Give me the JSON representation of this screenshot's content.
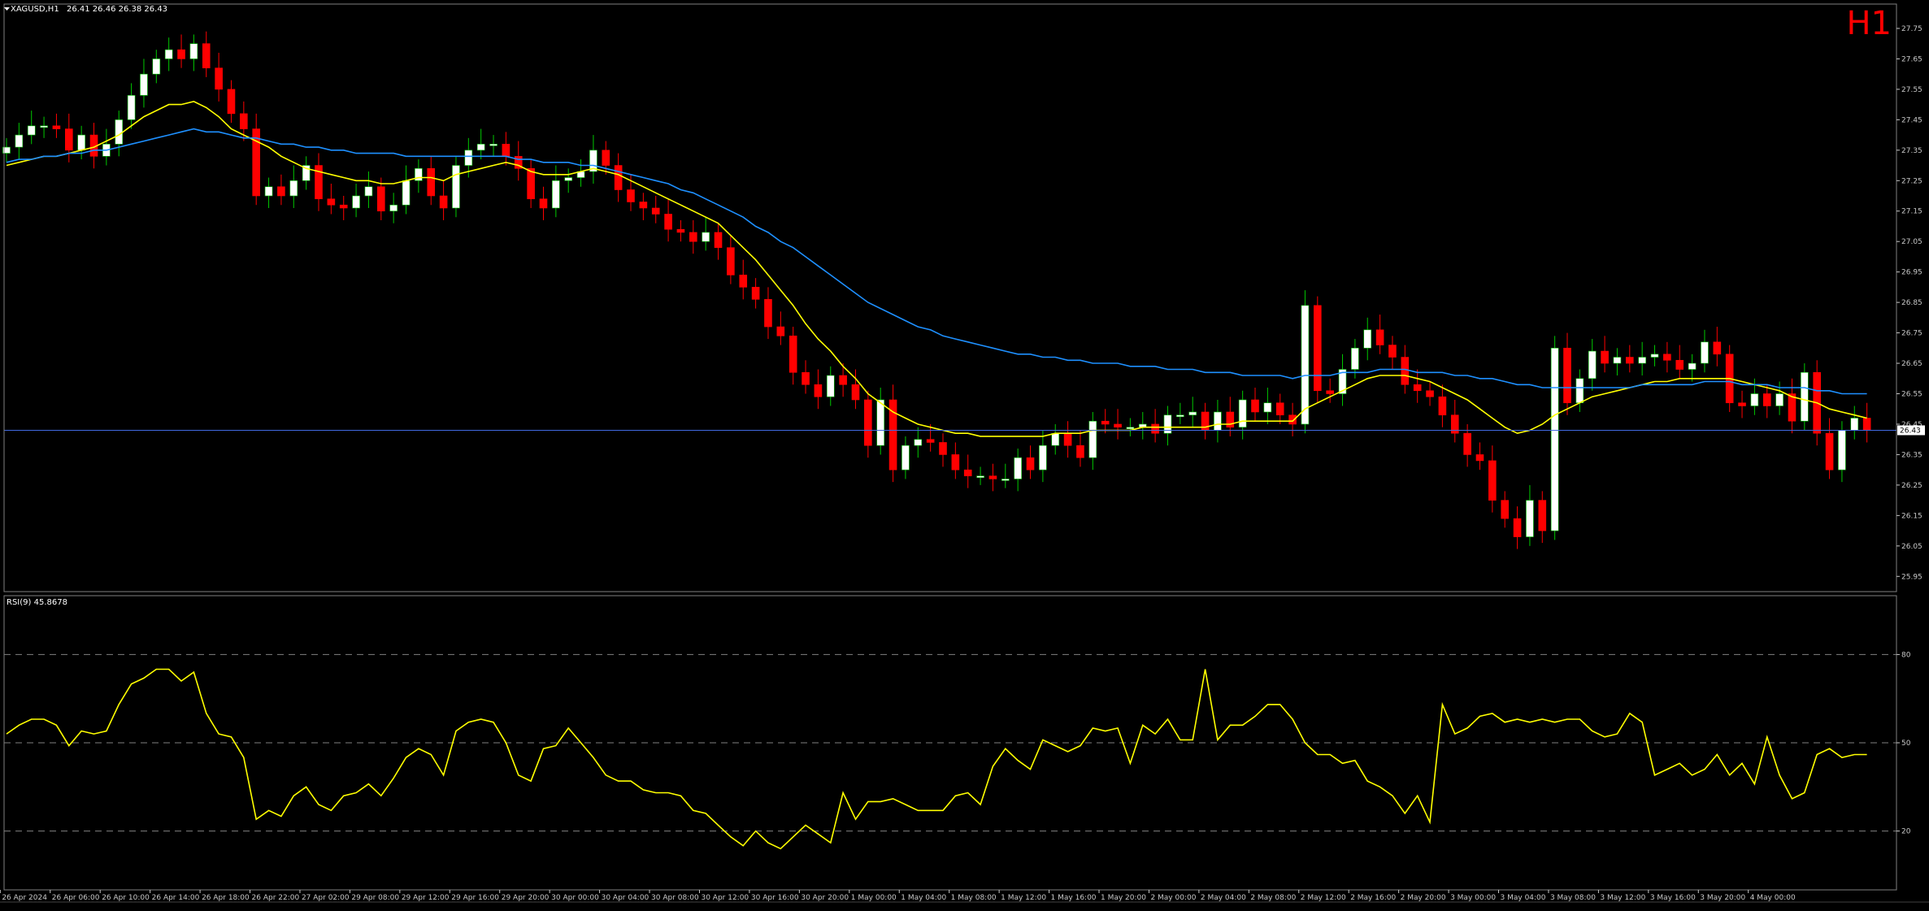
{
  "header": {
    "symbol": "XAGUSD,H1",
    "ohlc": "26.41 26.46 26.38 26.43",
    "timeframe": "H1"
  },
  "indicator": {
    "label": "RSI(9) 45.8678"
  },
  "colors": {
    "background": "#000000",
    "bull_body": "#ffffff",
    "bear_body": "#ff0000",
    "bull_wick": "#00c800",
    "bear_wick": "#ff0000",
    "ma_fast": "#ffff00",
    "ma_slow": "#1e90ff",
    "rsi": "#ffff00",
    "price_line": "#4169e1",
    "axis_text": "#c8c8c8",
    "timeframe_label": "#ff0000"
  },
  "chart_data": [
    {
      "type": "candlestick",
      "title": "XAGUSD,H1",
      "ylim": [
        25.9,
        27.83
      ],
      "y_ticks": [
        "27.75",
        "27.65",
        "27.55",
        "27.45",
        "27.35",
        "27.25",
        "27.15",
        "27.05",
        "26.95",
        "26.85",
        "26.75",
        "26.65",
        "26.55",
        "26.45",
        "26.35",
        "26.25",
        "26.15",
        "26.05",
        "25.95"
      ],
      "x_ticks": [
        "26 Apr 2024",
        "26 Apr 06:00",
        "26 Apr 10:00",
        "26 Apr 14:00",
        "26 Apr 18:00",
        "26 Apr 22:00",
        "27 Apr 02:00",
        "29 Apr 08:00",
        "29 Apr 12:00",
        "29 Apr 16:00",
        "29 Apr 20:00",
        "30 Apr 00:00",
        "30 Apr 04:00",
        "30 Apr 08:00",
        "30 Apr 12:00",
        "30 Apr 16:00",
        "30 Apr 20:00",
        "1 May 00:00",
        "1 May 04:00",
        "1 May 08:00",
        "1 May 12:00",
        "1 May 16:00",
        "1 May 20:00",
        "2 May 00:00",
        "2 May 04:00",
        "2 May 08:00",
        "2 May 12:00",
        "2 May 16:00",
        "2 May 20:00",
        "3 May 00:00",
        "3 May 04:00",
        "3 May 08:00",
        "3 May 12:00",
        "3 May 16:00",
        "3 May 20:00",
        "4 May 00:00"
      ],
      "current_price": "26.43",
      "closes": [
        27.36,
        27.4,
        27.43,
        27.43,
        27.42,
        27.35,
        27.4,
        27.33,
        27.37,
        27.45,
        27.53,
        27.6,
        27.65,
        27.68,
        27.65,
        27.7,
        27.62,
        27.55,
        27.47,
        27.42,
        27.2,
        27.23,
        27.2,
        27.25,
        27.3,
        27.19,
        27.17,
        27.16,
        27.2,
        27.23,
        27.15,
        27.17,
        27.25,
        27.29,
        27.2,
        27.16,
        27.3,
        27.35,
        27.37,
        27.37,
        27.33,
        27.29,
        27.19,
        27.16,
        27.25,
        27.26,
        27.28,
        27.35,
        27.3,
        27.22,
        27.18,
        27.16,
        27.14,
        27.09,
        27.08,
        27.05,
        27.08,
        27.03,
        26.94,
        26.9,
        26.86,
        26.77,
        26.74,
        26.62,
        26.58,
        26.54,
        26.61,
        26.58,
        26.53,
        26.38,
        26.53,
        26.3,
        26.38,
        26.4,
        26.39,
        26.35,
        26.3,
        26.28,
        26.28,
        26.27,
        26.27,
        26.34,
        26.3,
        26.38,
        26.42,
        26.38,
        26.34,
        26.46,
        26.45,
        26.44,
        26.44,
        26.45,
        26.42,
        26.48,
        26.48,
        26.49,
        26.43,
        26.49,
        26.44,
        26.53,
        26.49,
        26.52,
        26.48,
        26.45,
        26.84,
        26.56,
        26.55,
        26.63,
        26.7,
        26.76,
        26.71,
        26.67,
        26.58,
        26.56,
        26.54,
        26.48,
        26.42,
        26.35,
        26.33,
        26.2,
        26.14,
        26.08,
        26.2,
        26.1,
        26.7,
        26.52,
        26.6,
        26.69,
        26.65,
        26.67,
        26.65,
        26.67,
        26.68,
        26.66,
        26.63,
        26.65,
        26.72,
        26.68,
        26.52,
        26.51,
        26.55,
        26.51,
        26.55,
        26.46,
        26.62,
        26.42,
        26.3,
        26.43,
        26.47,
        26.43
      ],
      "series": [
        {
          "name": "MA",
          "color": "#ffff00",
          "values": [
            27.3,
            27.31,
            27.32,
            27.33,
            27.33,
            27.34,
            27.35,
            27.36,
            27.38,
            27.4,
            27.43,
            27.46,
            27.48,
            27.5,
            27.5,
            27.51,
            27.49,
            27.46,
            27.42,
            27.4,
            27.38,
            27.36,
            27.33,
            27.31,
            27.29,
            27.28,
            27.27,
            27.26,
            27.25,
            27.25,
            27.24,
            27.24,
            27.25,
            27.26,
            27.26,
            27.25,
            27.27,
            27.28,
            27.29,
            27.3,
            27.31,
            27.3,
            27.28,
            27.27,
            27.27,
            27.27,
            27.28,
            27.29,
            27.28,
            27.27,
            27.25,
            27.23,
            27.21,
            27.19,
            27.17,
            27.15,
            27.13,
            27.11,
            27.07,
            27.03,
            26.99,
            26.94,
            26.89,
            26.84,
            26.78,
            26.73,
            26.69,
            26.64,
            26.6,
            26.55,
            26.52,
            26.49,
            26.47,
            26.45,
            26.44,
            26.43,
            26.42,
            26.42,
            26.41,
            26.41,
            26.41,
            26.41,
            26.41,
            26.41,
            26.42,
            26.42,
            26.42,
            26.43,
            26.43,
            26.43,
            26.43,
            26.44,
            26.44,
            26.44,
            26.44,
            26.44,
            26.44,
            26.45,
            26.45,
            26.46,
            26.46,
            26.46,
            26.46,
            26.46,
            26.5,
            26.52,
            26.54,
            26.56,
            26.58,
            26.6,
            26.61,
            26.61,
            26.61,
            26.6,
            26.59,
            26.57,
            26.55,
            26.53,
            26.5,
            26.47,
            26.44,
            26.42,
            26.43,
            26.45,
            26.48,
            26.5,
            26.52,
            26.54,
            26.55,
            26.56,
            26.57,
            26.58,
            26.59,
            26.59,
            26.6,
            26.6,
            26.6,
            26.6,
            26.6,
            26.59,
            26.58,
            26.57,
            26.56,
            26.54,
            26.53,
            26.52,
            26.5,
            26.49,
            26.48,
            26.47
          ]
        },
        {
          "name": "MA",
          "color": "#1e90ff",
          "values": [
            27.31,
            27.32,
            27.32,
            27.33,
            27.33,
            27.34,
            27.34,
            27.35,
            27.35,
            27.36,
            27.37,
            27.38,
            27.39,
            27.4,
            27.41,
            27.42,
            27.41,
            27.41,
            27.4,
            27.39,
            27.39,
            27.38,
            27.37,
            27.37,
            27.36,
            27.36,
            27.35,
            27.35,
            27.34,
            27.34,
            27.34,
            27.34,
            27.33,
            27.33,
            27.33,
            27.33,
            27.33,
            27.33,
            27.33,
            27.33,
            27.33,
            27.32,
            27.32,
            27.31,
            27.31,
            27.31,
            27.3,
            27.3,
            27.29,
            27.28,
            27.27,
            27.26,
            27.25,
            27.24,
            27.22,
            27.21,
            27.19,
            27.17,
            27.15,
            27.13,
            27.1,
            27.08,
            27.05,
            27.03,
            27.0,
            26.97,
            26.94,
            26.91,
            26.88,
            26.85,
            26.83,
            26.81,
            26.79,
            26.77,
            26.76,
            26.74,
            26.73,
            26.72,
            26.71,
            26.7,
            26.69,
            26.68,
            26.68,
            26.67,
            26.67,
            26.66,
            26.66,
            26.65,
            26.65,
            26.65,
            26.64,
            26.64,
            26.64,
            26.63,
            26.63,
            26.63,
            26.62,
            26.62,
            26.62,
            26.61,
            26.61,
            26.61,
            26.61,
            26.6,
            26.61,
            26.61,
            26.61,
            26.62,
            26.62,
            26.62,
            26.63,
            26.63,
            26.63,
            26.62,
            26.62,
            26.62,
            26.61,
            26.61,
            26.6,
            26.6,
            26.59,
            26.58,
            26.58,
            26.57,
            26.57,
            26.57,
            26.57,
            26.57,
            26.57,
            26.57,
            26.57,
            26.58,
            26.58,
            26.58,
            26.58,
            26.58,
            26.59,
            26.59,
            26.59,
            26.58,
            26.58,
            26.58,
            26.57,
            26.57,
            26.57,
            26.56,
            26.56,
            26.55,
            26.55,
            26.55
          ]
        }
      ]
    },
    {
      "type": "line",
      "title": "RSI(9) 45.8678",
      "ylim": [
        0,
        100
      ],
      "levels": [
        80,
        50,
        20
      ],
      "y_ticks": [
        "80",
        "50",
        "20"
      ],
      "series": [
        {
          "name": "RSI(9)",
          "color": "#ffff00",
          "values": [
            53,
            56,
            58,
            58,
            56,
            49,
            54,
            53,
            54,
            63,
            70,
            72,
            75,
            75,
            71,
            74,
            60,
            53,
            52,
            45,
            24,
            27,
            25,
            32,
            35,
            29,
            27,
            32,
            33,
            36,
            32,
            38,
            45,
            48,
            46,
            39,
            54,
            57,
            58,
            57,
            50,
            39,
            37,
            48,
            49,
            55,
            50,
            45,
            39,
            37,
            37,
            34,
            33,
            33,
            32,
            27,
            26,
            22,
            18,
            15,
            20,
            16,
            14,
            18,
            22,
            19,
            16,
            33,
            24,
            30,
            30,
            31,
            29,
            27,
            27,
            27,
            32,
            33,
            29,
            42,
            48,
            44,
            41,
            51,
            49,
            47,
            49,
            55,
            54,
            55,
            43,
            56,
            53,
            58,
            51,
            51,
            75,
            51,
            56,
            56,
            59,
            63,
            63,
            58,
            50,
            46,
            46,
            43,
            44,
            37,
            35,
            32,
            26,
            32,
            23,
            63,
            53,
            55,
            59,
            60,
            57,
            58,
            57,
            58,
            57,
            58,
            58,
            54,
            52,
            53,
            60,
            57,
            39,
            41,
            43,
            39,
            41,
            46,
            39,
            43,
            36,
            52,
            39,
            31,
            33,
            46,
            48,
            45,
            46,
            46
          ]
        }
      ]
    }
  ]
}
